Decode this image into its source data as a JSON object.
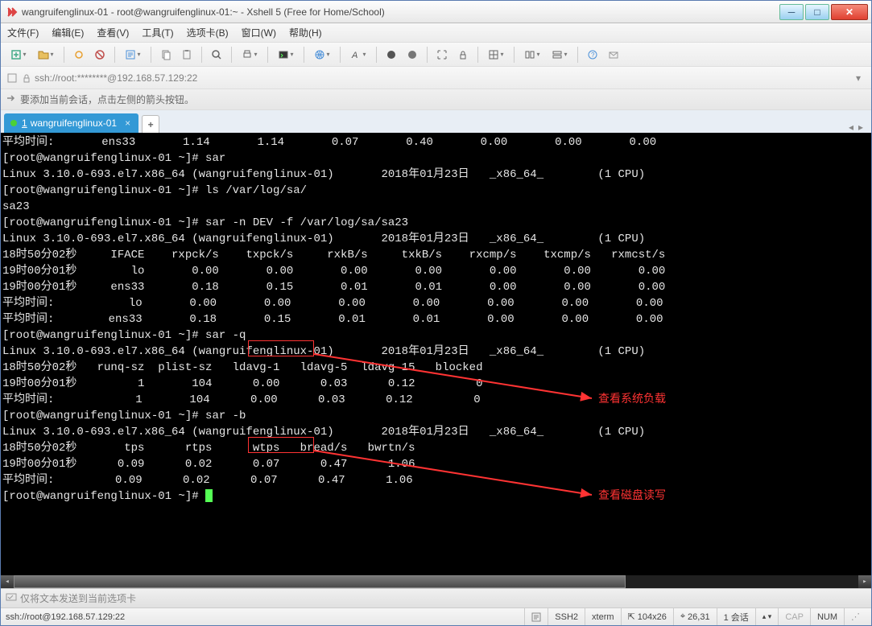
{
  "title": "wangruifenglinux-01 - root@wangruifenglinux-01:~ - Xshell 5 (Free for Home/School)",
  "menu": {
    "file": "文件(F)",
    "edit": "编辑(E)",
    "view": "查看(V)",
    "tools": "工具(T)",
    "tabs": "选项卡(B)",
    "window": "窗口(W)",
    "help": "帮助(H)"
  },
  "address": "ssh://root:********@192.168.57.129:22",
  "infobar_text": "要添加当前会话，点击左侧的箭头按钮。",
  "tab": {
    "num": "1",
    "name": "wangruifenglinux-01"
  },
  "annotations": {
    "load": "查看系统负载",
    "disk": "查看磁盘读写"
  },
  "sendbar_text": "仅将文本发送到当前选项卡",
  "status": {
    "conn": "ssh://root@192.168.57.129:22",
    "proto": "SSH2",
    "term": "xterm",
    "size": "104x26",
    "cursor": "26,31",
    "sessions": "1 会话",
    "cap": "CAP",
    "num": "NUM"
  },
  "terminal_lines": [
    "平均时间:       ens33       1.14       1.14       0.07       0.40       0.00       0.00       0.00",
    "[root@wangruifenglinux-01 ~]# sar",
    "Linux 3.10.0-693.el7.x86_64 (wangruifenglinux-01)       2018年01月23日   _x86_64_        (1 CPU)",
    "[root@wangruifenglinux-01 ~]# ls /var/log/sa/",
    "sa23",
    "[root@wangruifenglinux-01 ~]# sar -n DEV -f /var/log/sa/sa23",
    "Linux 3.10.0-693.el7.x86_64 (wangruifenglinux-01)       2018年01月23日   _x86_64_        (1 CPU)",
    "",
    "18时50分02秒     IFACE    rxpck/s    txpck/s     rxkB/s     txkB/s    rxcmp/s    txcmp/s   rxmcst/s",
    "19时00分01秒        lo       0.00       0.00       0.00       0.00       0.00       0.00       0.00",
    "19时00分01秒     ens33       0.18       0.15       0.01       0.01       0.00       0.00       0.00",
    "平均时间:           lo       0.00       0.00       0.00       0.00       0.00       0.00       0.00",
    "平均时间:        ens33       0.18       0.15       0.01       0.01       0.00       0.00       0.00",
    "[root@wangruifenglinux-01 ~]# sar -q",
    "Linux 3.10.0-693.el7.x86_64 (wangruifenglinux-01)       2018年01月23日   _x86_64_        (1 CPU)",
    "",
    "18时50分02秒   runq-sz  plist-sz   ldavg-1   ldavg-5  ldavg-15   blocked",
    "19时00分01秒         1       104      0.00      0.03      0.12         0",
    "平均时间:            1       104      0.00      0.03      0.12         0",
    "[root@wangruifenglinux-01 ~]# sar -b",
    "Linux 3.10.0-693.el7.x86_64 (wangruifenglinux-01)       2018年01月23日   _x86_64_        (1 CPU)",
    "",
    "18时50分02秒       tps      rtps      wtps   bread/s   bwrtn/s",
    "19时00分01秒      0.09      0.02      0.07      0.47      1.06",
    "平均时间:         0.09      0.02      0.07      0.47      1.06",
    "[root@wangruifenglinux-01 ~]# "
  ]
}
